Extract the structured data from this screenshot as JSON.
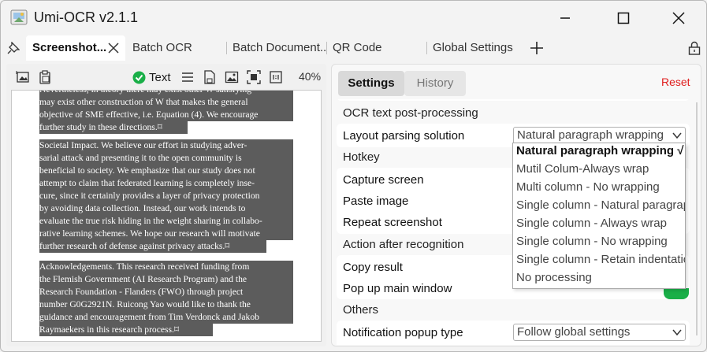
{
  "window": {
    "title": "Umi-OCR v2.1.1"
  },
  "tabs": [
    {
      "label": "Screenshot...",
      "active": true
    },
    {
      "label": "Batch OCR"
    },
    {
      "label": "Batch Document..."
    },
    {
      "label": "QR Code"
    },
    {
      "label": "Global Settings"
    }
  ],
  "toolbar": {
    "text_toggle_label": "Text",
    "zoom": "40%"
  },
  "document": {
    "paragraphs": [
      {
        "lines": [
          "Nevertheless, in theory there may exist other W satisfying",
          "may exist other construction of W that makes the general",
          "objective of SME effective, i.e. Equation (4). We encourage",
          "further study in these directions.⌑"
        ]
      },
      {
        "lines": [
          "Societal Impact. We believe our effort in studying adver-",
          "sarial attack and presenting it to the open community is",
          "beneficial to society. We emphasize that our study does not",
          "attempt to claim that federated learning is completely inse-",
          "cure, since it certainly provides a layer of privacy protection",
          "by avoiding data collection. Instead, our work intends to",
          "evaluate the true risk hiding in the weight sharing in collabo-",
          "rative learning schemes. We hope our research will motivate",
          "further research of defense against privacy attacks.⌑"
        ]
      },
      {
        "lines": [
          "Acknowledgements. This research received funding from",
          "the Flemish Government (AI Research Program) and the",
          "Research Foundation - Flanders (FWO) through project",
          "number G0G2921N. Ruicong Yao would like to thank the",
          "guidance and encouragement from Tim Verdonck and Jakob",
          "Raymaekers in this research process.⌑"
        ]
      }
    ]
  },
  "settings": {
    "tab_settings": "Settings",
    "tab_history": "History",
    "reset": "Reset",
    "sections": {
      "post_processing": "OCR text post-processing",
      "hotkey": "Hotkey",
      "action_after": "Action after recognition",
      "others": "Others"
    },
    "rows": {
      "layout_parsing": "Layout parsing solution",
      "layout_parsing_value": "Natural paragraph wrapping",
      "capture_screen": "Capture screen",
      "paste_image": "Paste image",
      "repeat_screenshot": "Repeat screenshot",
      "copy_result": "Copy result",
      "popup_main": "Pop up main window",
      "notification_type": "Notification popup type",
      "notification_value": "Follow global settings"
    },
    "dropdown_options": [
      "Natural paragraph wrapping √",
      "Mutil Colum-Always wrap",
      "Multi column - No wrapping",
      "Single column - Natural paragraph",
      "Single column - Always wrap",
      "Single column - No wrapping",
      "Single column - Retain indentation",
      "No processing"
    ],
    "dropdown_selected_index": 0
  },
  "colors": {
    "accent_green": "#1aaf48",
    "reset_red": "#e02020",
    "highlight": "#5c5c5c"
  }
}
